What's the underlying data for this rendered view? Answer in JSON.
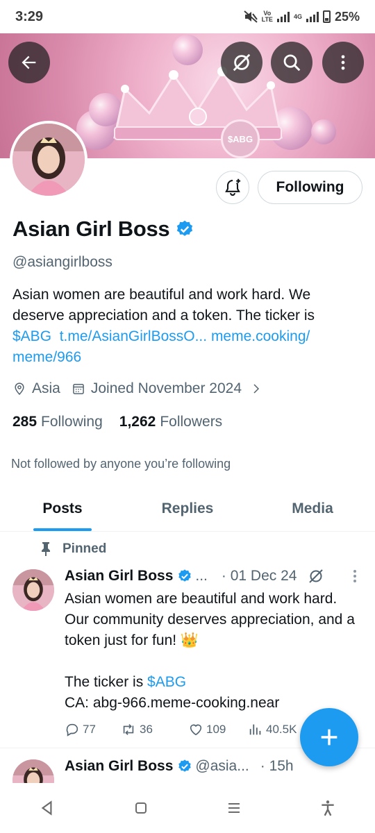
{
  "status_bar": {
    "time": "3:29",
    "network": "Vo LTE 4G",
    "battery": "25%"
  },
  "banner": {
    "badge_text": "$ABG"
  },
  "profile": {
    "name": "Asian Girl Boss",
    "handle": "@asiangirlboss",
    "follow_button_label": "Following",
    "bio": {
      "text": "Asian women are beautiful and work hard. We deserve appreciation and a token. The ticker is",
      "cashtag": "$ABG",
      "link1": "t.me/AsianGirlBossO...",
      "link2_a": "meme.cooking/",
      "link2_b": "meme/966"
    },
    "location": "Asia",
    "joined": "Joined November 2024",
    "following_count": "285",
    "following_label": "Following",
    "followers_count": "1,262",
    "followers_label": "Followers",
    "not_followed_text": "Not followed by anyone you’re following"
  },
  "tabs": [
    {
      "label": "Posts",
      "active": true
    },
    {
      "label": "Replies",
      "active": false
    },
    {
      "label": "Media",
      "active": false
    }
  ],
  "pinned_label": "Pinned",
  "posts": [
    {
      "author": "Asian Girl Boss",
      "handle": "...",
      "date": "· 01 Dec 24",
      "body_line1": "Asian women are beautiful and work hard.  Our community deserves appreciation, and a token just for fun! 👑",
      "body_ticker_prefix": "The ticker is ",
      "body_ticker": "$ABG",
      "body_ca": "CA: abg-966.meme-cooking.near",
      "replies": "77",
      "reposts": "36",
      "likes": "109",
      "views": "40.5K"
    },
    {
      "author": "Asian Girl Boss",
      "handle": "@asia...",
      "date": "· 15h"
    }
  ],
  "colors": {
    "accent": "#1d9bf0",
    "text": "#0f1419",
    "muted": "#536471"
  }
}
